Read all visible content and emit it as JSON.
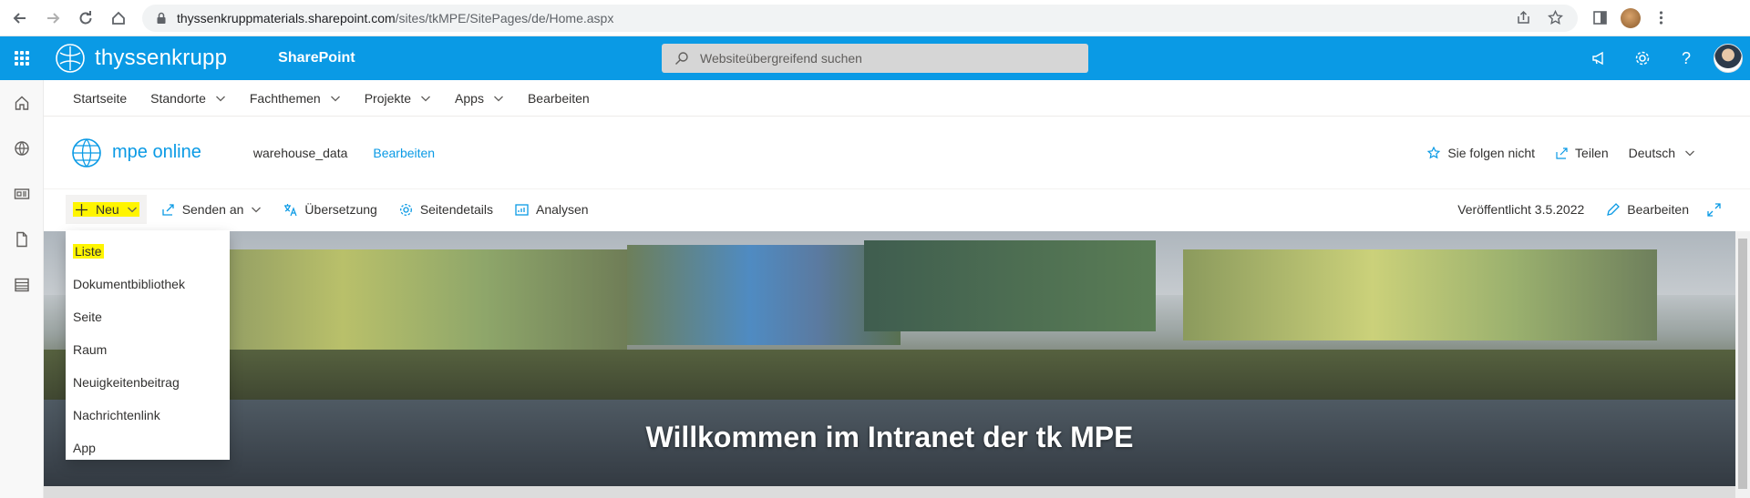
{
  "browser": {
    "url_host": "thyssenkruppmaterials.sharepoint.com",
    "url_path": "/sites/tkMPE/SitePages/de/Home.aspx"
  },
  "suite": {
    "brand": "thyssenkrupp",
    "app": "SharePoint",
    "search_placeholder": "Websiteübergreifend suchen",
    "help_label": "?"
  },
  "hub_nav": {
    "items": [
      {
        "label": "Startseite"
      },
      {
        "label": "Standorte"
      },
      {
        "label": "Fachthemen"
      },
      {
        "label": "Projekte"
      },
      {
        "label": "Apps"
      },
      {
        "label": "Bearbeiten"
      }
    ]
  },
  "site": {
    "title": "mpe online",
    "link": "warehouse_data",
    "edit": "Bearbeiten",
    "follow": "Sie folgen nicht",
    "share": "Teilen",
    "language": "Deutsch"
  },
  "command_bar": {
    "new": "Neu",
    "send": "Senden an",
    "translate": "Übersetzung",
    "page_details": "Seitendetails",
    "analytics": "Analysen",
    "published": "Veröffentlicht 3.5.2022",
    "edit": "Bearbeiten"
  },
  "new_menu": {
    "items": [
      {
        "label": "Liste"
      },
      {
        "label": "Dokumentbibliothek"
      },
      {
        "label": "Seite"
      },
      {
        "label": "Raum"
      },
      {
        "label": "Neuigkeitenbeitrag"
      },
      {
        "label": "Nachrichtenlink"
      },
      {
        "label": "App"
      }
    ]
  },
  "hero": {
    "title": "Willkommen im Intranet der tk MPE"
  },
  "colors": {
    "accent": "#0a9ae5",
    "highlight": "#fff500"
  }
}
